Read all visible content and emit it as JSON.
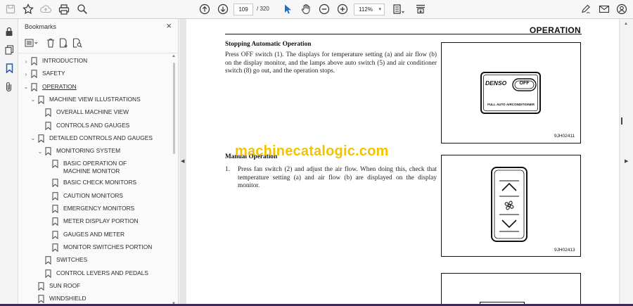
{
  "toolbar": {
    "page_current": "109",
    "page_total": "/ 320",
    "zoom": "112%",
    "icons": [
      "save-icon",
      "bookmark-star-icon",
      "cloud-upload-icon",
      "print-icon",
      "zoom-search-icon",
      "page-up-icon",
      "page-down-icon",
      "select-cursor-icon",
      "hand-pan-icon",
      "zoom-out-icon",
      "zoom-in-icon",
      "page-fit-icon",
      "scroll-mode-icon",
      "sign-pen-icon",
      "share-mail-icon",
      "account-icon"
    ]
  },
  "rail": {
    "icons": [
      "lock-icon",
      "copy-icon",
      "bookmark-icon",
      "attachment-icon"
    ]
  },
  "panel": {
    "title": "Bookmarks",
    "close": "×",
    "bookmarks": [
      {
        "label": "INTRODUCTION",
        "level": 0,
        "chevron": "›"
      },
      {
        "label": "SAFETY",
        "level": 0,
        "chevron": "›"
      },
      {
        "label": "OPERATION",
        "level": 0,
        "chevron": "⌄",
        "underline": true
      },
      {
        "label": "MACHINE VIEW ILLUSTRATIONS",
        "level": 1,
        "chevron": "⌄"
      },
      {
        "label": "OVERALL MACHINE VIEW",
        "level": 2,
        "chevron": ""
      },
      {
        "label": "CONTROLS AND GAUGES",
        "level": 2,
        "chevron": ""
      },
      {
        "label": "DETAILED CONTROLS AND GAUGES",
        "level": 1,
        "chevron": "⌄"
      },
      {
        "label": "MONITORING SYSTEM",
        "level": 2,
        "chevron": "⌄"
      },
      {
        "label": "BASIC OPERATION OF MACHINE MONITOR",
        "level": 3,
        "chevron": "",
        "two_line": true
      },
      {
        "label": "BASIC CHECK MONITORS",
        "level": 3,
        "chevron": ""
      },
      {
        "label": "CAUTION MONITORS",
        "level": 3,
        "chevron": ""
      },
      {
        "label": "EMERGENCY MONITORS",
        "level": 3,
        "chevron": ""
      },
      {
        "label": "METER DISPLAY PORTION",
        "level": 3,
        "chevron": ""
      },
      {
        "label": "GAUGES AND METER",
        "level": 3,
        "chevron": ""
      },
      {
        "label": "MONITOR SWITCHES PORTION",
        "level": 3,
        "chevron": ""
      },
      {
        "label": "SWITCHES",
        "level": 2,
        "chevron": ""
      },
      {
        "label": "CONTROL LEVERS AND PEDALS",
        "level": 2,
        "chevron": ""
      },
      {
        "label": "SUN ROOF",
        "level": 1,
        "chevron": ""
      },
      {
        "label": "WINDSHIELD",
        "level": 1,
        "chevron": ""
      }
    ]
  },
  "document": {
    "section_title": "OPERATION",
    "heading1": "Stopping Automatic Operation",
    "para1": "Press OFF switch (1). The displays for temperature setting (a) and air flow (b) on the display monitor, and the lamps above auto switch (5) and air conditioner switch (8) go out, and the operation stops.",
    "heading2": "Manual Operation",
    "step1_num": "1.",
    "step1_text": "Press fan switch (2) and adjust the air flow. When doing this, check that temperature setting (a) and air flow (b) are displayed on the display monitor.",
    "fig1_code": "9JH02411",
    "fig2_code": "9JH02413",
    "panel_brand": "DENSO",
    "panel_off": "OFF",
    "panel_caption": "FULL AUTO AIRCONDITIONER",
    "watermark": "machinecatalogic.com"
  }
}
